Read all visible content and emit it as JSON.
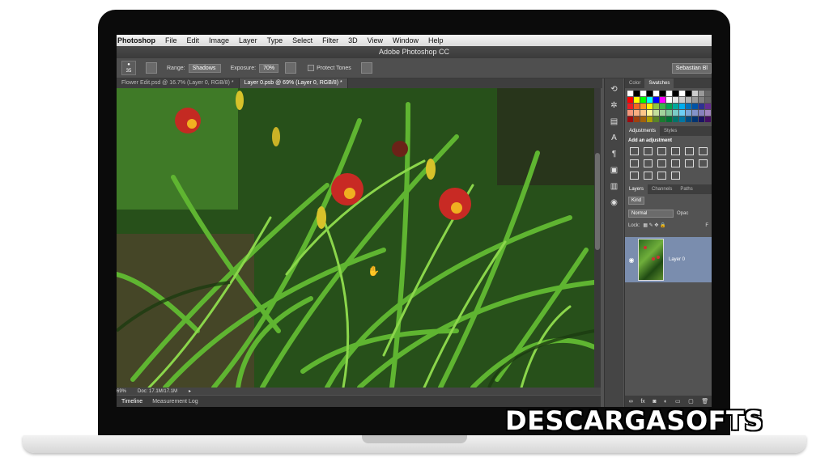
{
  "menubar": {
    "app": "Photoshop",
    "items": [
      "File",
      "Edit",
      "Image",
      "Layer",
      "Type",
      "Select",
      "Filter",
      "3D",
      "View",
      "Window",
      "Help"
    ]
  },
  "window_title": "Adobe Photoshop CC",
  "options": {
    "brush_size": "35",
    "range_label": "Range:",
    "range_value": "Shadows",
    "exposure_label": "Exposure:",
    "exposure_value": "70%",
    "protect_tones": "Protect Tones",
    "workspace": "Sebastian Bl"
  },
  "doc_tabs": [
    {
      "label": "Flower Edit.psd @ 16.7% (Layer 0, RGB/8) *",
      "active": false
    },
    {
      "label": "Layer 0.psb @ 69% (Layer 0, RGB/8) *",
      "active": true
    }
  ],
  "status": {
    "zoom": "69%",
    "doc": "Doc: 17.1M/17.1M"
  },
  "bottom_tabs": [
    "Timeline",
    "Measurement Log"
  ],
  "panels": {
    "color_tabs": [
      "Color",
      "Swatches"
    ],
    "adjust_tabs": [
      "Adjustments",
      "Styles"
    ],
    "add_adjustment": "Add an adjustment",
    "layer_tabs": [
      "Layers",
      "Channels",
      "Paths"
    ],
    "kind": "Kind",
    "blend_mode": "Normal",
    "opacity": "Opac",
    "lock": "Lock:",
    "fill": "F",
    "layer_name": "Layer 0"
  },
  "colors": {
    "swatches": [
      "#ffffff",
      "#000000",
      "#ffffff",
      "#000000",
      "#ffffff",
      "#000000",
      "#ffffff",
      "#000000",
      "#ffffff",
      "#000000",
      "#cccccc",
      "#999999",
      "#666666",
      "#333333",
      "#ff0000",
      "#ffff00",
      "#00ff00",
      "#00ffff",
      "#0000ff",
      "#ff00ff",
      "#ffffff",
      "#e6e6e6",
      "#cccccc",
      "#b3b3b3",
      "#999999",
      "#808080",
      "#666666",
      "#4d4d4d",
      "#ed1c24",
      "#f26522",
      "#f7941d",
      "#fff200",
      "#8dc63f",
      "#39b54a",
      "#00a651",
      "#00a99d",
      "#00aeef",
      "#0072bc",
      "#0054a6",
      "#2e3192",
      "#662d91",
      "#92278f",
      "#f7977a",
      "#f9ad81",
      "#fdc689",
      "#fff799",
      "#c4df9b",
      "#a3d39c",
      "#82ca9c",
      "#7accc8",
      "#6dcff6",
      "#7da7d9",
      "#8393ca",
      "#8781bd",
      "#a186be",
      "#bd8cbf",
      "#9e0b0f",
      "#a0410d",
      "#a3620a",
      "#aba000",
      "#598527",
      "#1a7b30",
      "#007236",
      "#00746b",
      "#0076a3",
      "#004a80",
      "#003471",
      "#1b1464",
      "#440e62",
      "#630460"
    ],
    "layer_selected": "#7a8dae"
  }
}
